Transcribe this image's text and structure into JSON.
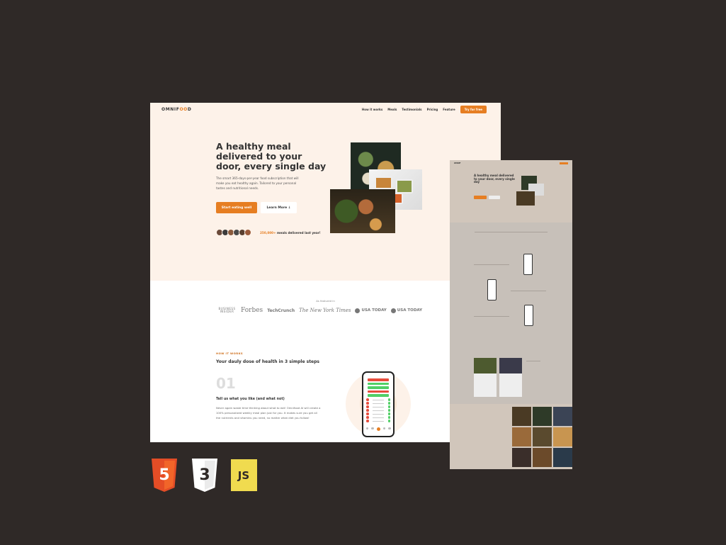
{
  "nav": {
    "logo_prefix": "OMNIF",
    "logo_accent": "OO",
    "logo_suffix": "D",
    "links": [
      "How it works",
      "Meals",
      "Testimonials",
      "Pricing",
      "Feature"
    ],
    "cta": "Try for free"
  },
  "hero": {
    "title": "A healthy meal delivered to your door, every single day",
    "description": "The smart 365-days-per-year food subscription that will make you eat healthy again. Tailored to your personal tastes and nutritional needs.",
    "primary_button": "Start eating well",
    "secondary_button": "Learn More ↓",
    "delivered_count": "250,000+",
    "delivered_text": " meals delivered last year!"
  },
  "press": {
    "label": "As featured in",
    "logos": [
      "BUSINESS INSIDER",
      "Forbes",
      "TechCrunch",
      "The New York Times",
      "USA TODAY",
      "USA TODAY"
    ]
  },
  "how": {
    "subheading": "HOW IT WORKS",
    "title": "Your dauly dose of health in 3 simple steps",
    "step_number": "01",
    "step_title": "Tell us what you like (and what not)",
    "step_desc": "Never again waste time thinking about what to eat! Omnifood AI will create a 100% personalized weekly meal plan just for you. It makes sure you get all the nutrients and vitamins you need, no matter what diet you follow!"
  },
  "tech_badges": {
    "html": "5",
    "css": "3",
    "js": "JS"
  },
  "colors": {
    "background": "#2f2927",
    "accent": "#e67e22",
    "hero_bg": "#fdf2e9",
    "html5": "#e44d26",
    "css3": "#ffffff",
    "js": "#f0db4f"
  }
}
